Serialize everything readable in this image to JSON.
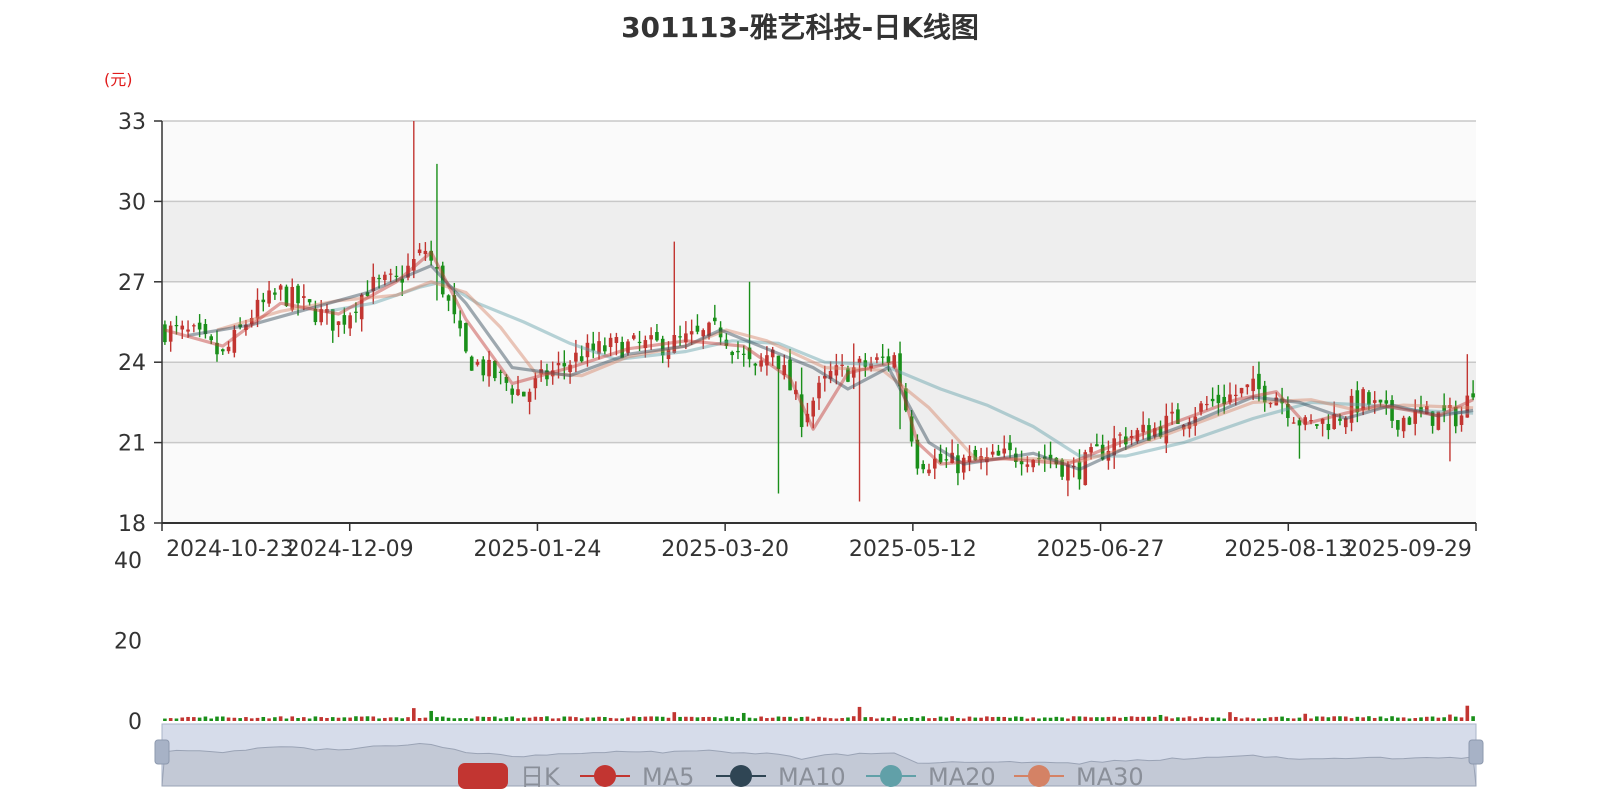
{
  "title": "301113-雅艺科技-日K线图",
  "unit": "(元)",
  "chart_data": {
    "type": "candlestick",
    "price_axis": {
      "ticks": [
        18,
        21,
        24,
        27,
        30,
        33
      ],
      "range": [
        18,
        33
      ]
    },
    "volume_axis": {
      "ticks": [
        0,
        20,
        40
      ],
      "range": [
        0,
        40
      ]
    },
    "x_tick_labels": [
      "2024-10-23",
      "2024-12-09",
      "2025-01-24",
      "2025-03-20",
      "2025-05-12",
      "2025-06-27",
      "2025-08-13",
      "2025-09-29"
    ],
    "up_color": "#c23531",
    "down_color": "#1a8f1a",
    "grid": true,
    "legend": [
      {
        "name": "日K",
        "color": "#c23531"
      },
      {
        "name": "MA5",
        "color": "#c23531"
      },
      {
        "name": "MA10",
        "color": "#2f4554"
      },
      {
        "name": "MA20",
        "color": "#61a0a8"
      },
      {
        "name": "MA30",
        "color": "#d48265"
      }
    ],
    "legend_position": "bottom-center",
    "close_path": [
      [
        0,
        25.2
      ],
      [
        5,
        25.0
      ],
      [
        10,
        24.2
      ],
      [
        15,
        25.8
      ],
      [
        20,
        26.6
      ],
      [
        25,
        26.0
      ],
      [
        30,
        25.4
      ],
      [
        35,
        26.8
      ],
      [
        40,
        27.0
      ],
      [
        45,
        28.2
      ],
      [
        48,
        26.8
      ],
      [
        52,
        24.2
      ],
      [
        57,
        23.5
      ],
      [
        62,
        22.8
      ],
      [
        66,
        23.5
      ],
      [
        72,
        24.3
      ],
      [
        78,
        24.6
      ],
      [
        84,
        24.6
      ],
      [
        90,
        24.8
      ],
      [
        96,
        25.2
      ],
      [
        102,
        23.6
      ],
      [
        105,
        24.6
      ],
      [
        110,
        22.0
      ],
      [
        115,
        23.5
      ],
      [
        120,
        23.8
      ],
      [
        126,
        24.2
      ],
      [
        130,
        20.4
      ],
      [
        136,
        20.2
      ],
      [
        142,
        20.3
      ],
      [
        148,
        20.6
      ],
      [
        153,
        20.4
      ],
      [
        157,
        19.9
      ],
      [
        160,
        20.4
      ],
      [
        165,
        21.2
      ],
      [
        170,
        21.4
      ],
      [
        176,
        22.0
      ],
      [
        182,
        22.6
      ],
      [
        188,
        23.0
      ],
      [
        192,
        22.8
      ],
      [
        197,
        21.6
      ],
      [
        202,
        21.9
      ],
      [
        207,
        22.6
      ],
      [
        212,
        21.9
      ],
      [
        218,
        22.0
      ],
      [
        224,
        22.0
      ],
      [
        226,
        23.1
      ]
    ],
    "ma5": [
      [
        0,
        25.2
      ],
      [
        10,
        24.6
      ],
      [
        20,
        26.2
      ],
      [
        30,
        25.8
      ],
      [
        40,
        27.0
      ],
      [
        46,
        28.1
      ],
      [
        52,
        25.6
      ],
      [
        60,
        23.2
      ],
      [
        70,
        23.8
      ],
      [
        80,
        24.5
      ],
      [
        90,
        24.8
      ],
      [
        100,
        24.6
      ],
      [
        108,
        23.4
      ],
      [
        112,
        21.5
      ],
      [
        118,
        23.6
      ],
      [
        126,
        24.0
      ],
      [
        130,
        21.0
      ],
      [
        134,
        20.2
      ],
      [
        145,
        20.4
      ],
      [
        156,
        20.2
      ],
      [
        165,
        21.0
      ],
      [
        175,
        21.8
      ],
      [
        185,
        22.6
      ],
      [
        192,
        22.9
      ],
      [
        197,
        21.7
      ],
      [
        204,
        22.1
      ],
      [
        210,
        22.4
      ],
      [
        220,
        22.0
      ],
      [
        226,
        22.6
      ]
    ],
    "ma10": [
      [
        4,
        25.0
      ],
      [
        15,
        25.4
      ],
      [
        25,
        26.0
      ],
      [
        35,
        26.6
      ],
      [
        46,
        27.6
      ],
      [
        52,
        26.2
      ],
      [
        60,
        23.8
      ],
      [
        70,
        23.5
      ],
      [
        80,
        24.3
      ],
      [
        90,
        24.6
      ],
      [
        96,
        25.2
      ],
      [
        104,
        24.5
      ],
      [
        112,
        23.8
      ],
      [
        118,
        23.0
      ],
      [
        125,
        23.8
      ],
      [
        132,
        21.0
      ],
      [
        138,
        20.2
      ],
      [
        150,
        20.6
      ],
      [
        158,
        20.0
      ],
      [
        168,
        21.0
      ],
      [
        178,
        21.8
      ],
      [
        188,
        22.7
      ],
      [
        196,
        22.5
      ],
      [
        204,
        21.9
      ],
      [
        212,
        22.4
      ],
      [
        220,
        22.0
      ],
      [
        226,
        22.2
      ]
    ],
    "ma20": [
      [
        9,
        25.2
      ],
      [
        20,
        25.9
      ],
      [
        30,
        26.3
      ],
      [
        40,
        26.5
      ],
      [
        46,
        27.0
      ],
      [
        52,
        26.6
      ],
      [
        58,
        25.3
      ],
      [
        64,
        23.6
      ],
      [
        72,
        23.5
      ],
      [
        80,
        24.2
      ],
      [
        90,
        24.6
      ],
      [
        97,
        25.2
      ],
      [
        104,
        24.8
      ],
      [
        114,
        23.8
      ],
      [
        124,
        23.7
      ],
      [
        132,
        22.3
      ],
      [
        140,
        20.4
      ],
      [
        150,
        20.4
      ],
      [
        158,
        20.3
      ],
      [
        168,
        20.9
      ],
      [
        178,
        21.7
      ],
      [
        188,
        22.5
      ],
      [
        198,
        22.6
      ],
      [
        206,
        22.2
      ],
      [
        214,
        22.4
      ],
      [
        226,
        22.3
      ]
    ],
    "ma30": [
      [
        28,
        25.9
      ],
      [
        36,
        26.2
      ],
      [
        44,
        26.8
      ],
      [
        48,
        27.0
      ],
      [
        54,
        26.2
      ],
      [
        62,
        25.5
      ],
      [
        70,
        24.7
      ],
      [
        78,
        24.1
      ],
      [
        90,
        24.4
      ],
      [
        98,
        24.8
      ],
      [
        106,
        24.7
      ],
      [
        114,
        24.0
      ],
      [
        124,
        23.9
      ],
      [
        134,
        23.0
      ],
      [
        142,
        22.4
      ],
      [
        150,
        21.6
      ],
      [
        158,
        20.5
      ],
      [
        166,
        20.5
      ],
      [
        176,
        21.0
      ],
      [
        188,
        21.9
      ],
      [
        198,
        22.5
      ],
      [
        208,
        22.4
      ],
      [
        216,
        22.2
      ],
      [
        226,
        22.1
      ]
    ],
    "spikes": [
      [
        43,
        33.0
      ],
      [
        47,
        31.4
      ],
      [
        47,
        26.3
      ],
      [
        88,
        28.5
      ],
      [
        101,
        27.0
      ],
      [
        104,
        24.6
      ],
      [
        104,
        23.5
      ],
      [
        106,
        19.1
      ],
      [
        110,
        23.8
      ],
      [
        119,
        24.7
      ],
      [
        120,
        18.8
      ],
      [
        127,
        21.5
      ],
      [
        156,
        19.0
      ],
      [
        196,
        20.4
      ],
      [
        222,
        20.3
      ],
      [
        225,
        24.3
      ]
    ],
    "volume_spikes": [
      [
        43,
        3.2
      ],
      [
        46,
        2.5
      ],
      [
        88,
        2.2
      ],
      [
        100,
        2.0
      ],
      [
        120,
        3.5
      ],
      [
        172,
        1.5
      ],
      [
        184,
        2.2
      ],
      [
        197,
        1.8
      ],
      [
        222,
        1.6
      ],
      [
        225,
        3.8
      ]
    ]
  }
}
